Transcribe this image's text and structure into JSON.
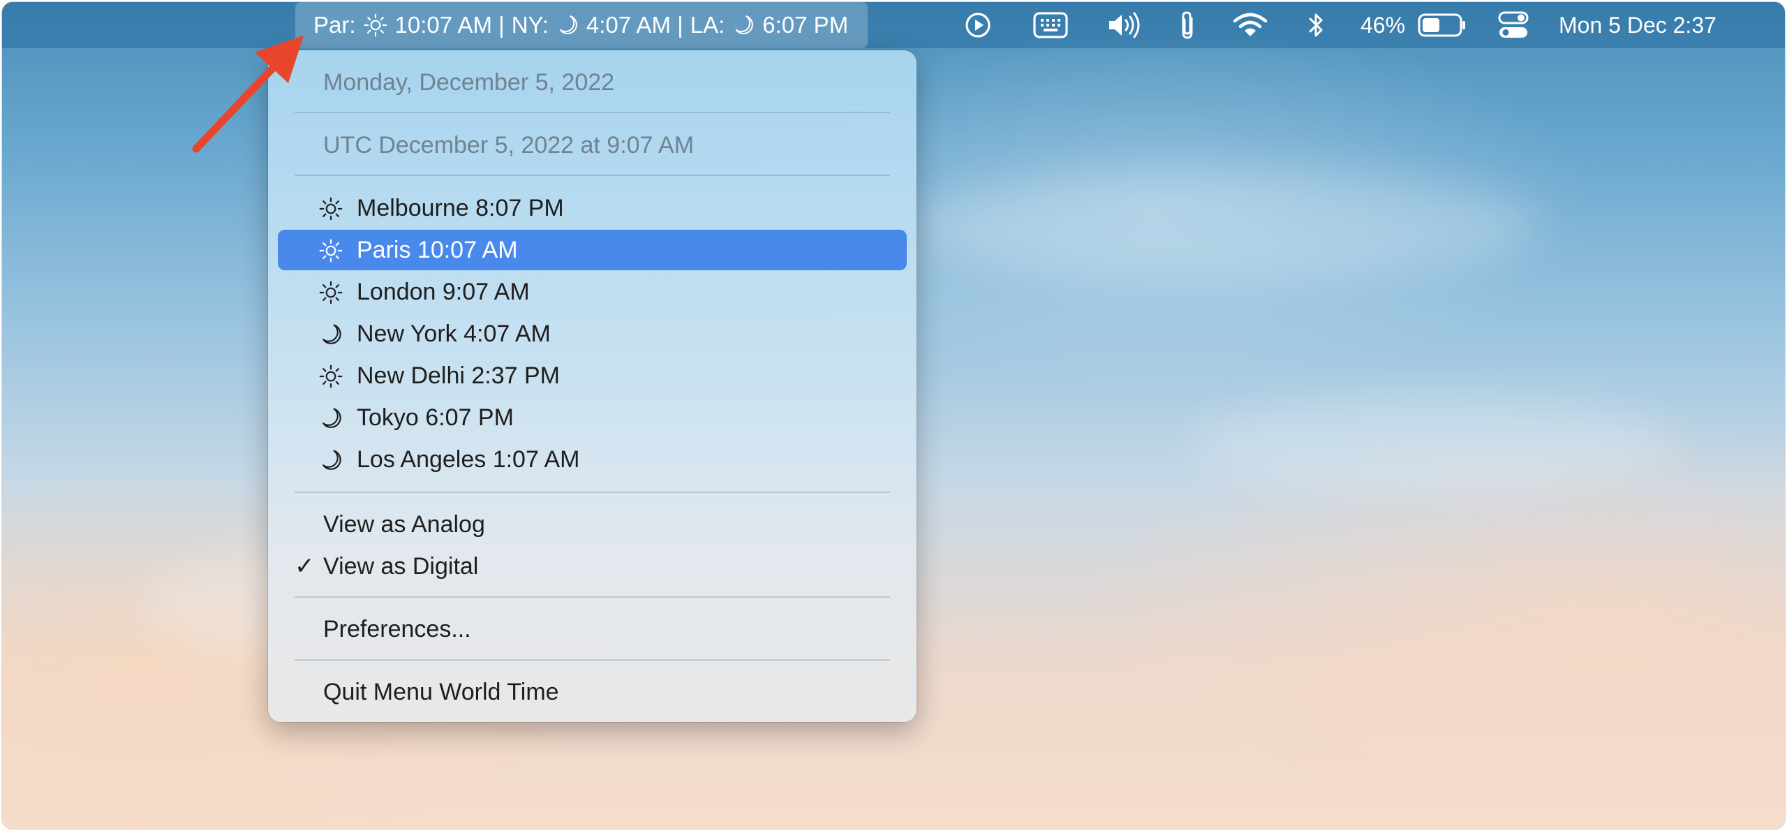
{
  "menubar": {
    "world_time": {
      "paris": "Par:",
      "paris_time": "10:07 AM |",
      "ny": "NY:",
      "ny_time": "4:07 AM |",
      "la": "LA:",
      "la_time": "6:07 PM"
    },
    "icons": [
      "play-circle-icon",
      "keyboard-grid-icon",
      "volume-icon",
      "paperclip-icon",
      "wifi-icon",
      "bluetooth-icon",
      "battery-icon",
      "control-center-icon"
    ],
    "battery_percent": "46%",
    "datetime": "Mon 5 Dec  2:37"
  },
  "menu": {
    "date": "Monday, December 5, 2022",
    "utc": "UTC December 5, 2022 at 9:07 AM",
    "cities": [
      {
        "label": "Melbourne 8:07 PM",
        "icon": "sun-icon"
      },
      {
        "label": "Paris 10:07 AM",
        "icon": "sun-icon"
      },
      {
        "label": "London 9:07 AM",
        "icon": "sun-icon"
      },
      {
        "label": "New York 4:07 AM",
        "icon": "moon-icon"
      },
      {
        "label": "New Delhi 2:37 PM",
        "icon": "sun-icon"
      },
      {
        "label": "Tokyo 6:07 PM",
        "icon": "moon-icon"
      },
      {
        "label": "Los Angeles 1:07 AM",
        "icon": "moon-icon"
      }
    ],
    "view_analog": "View as Analog",
    "view_digital": "View as Digital",
    "checkmark": "✓",
    "preferences": "Preferences...",
    "quit": "Quit Menu World Time"
  },
  "colors": {
    "highlight": "#4a89ec",
    "arrow": "#e8452c"
  }
}
